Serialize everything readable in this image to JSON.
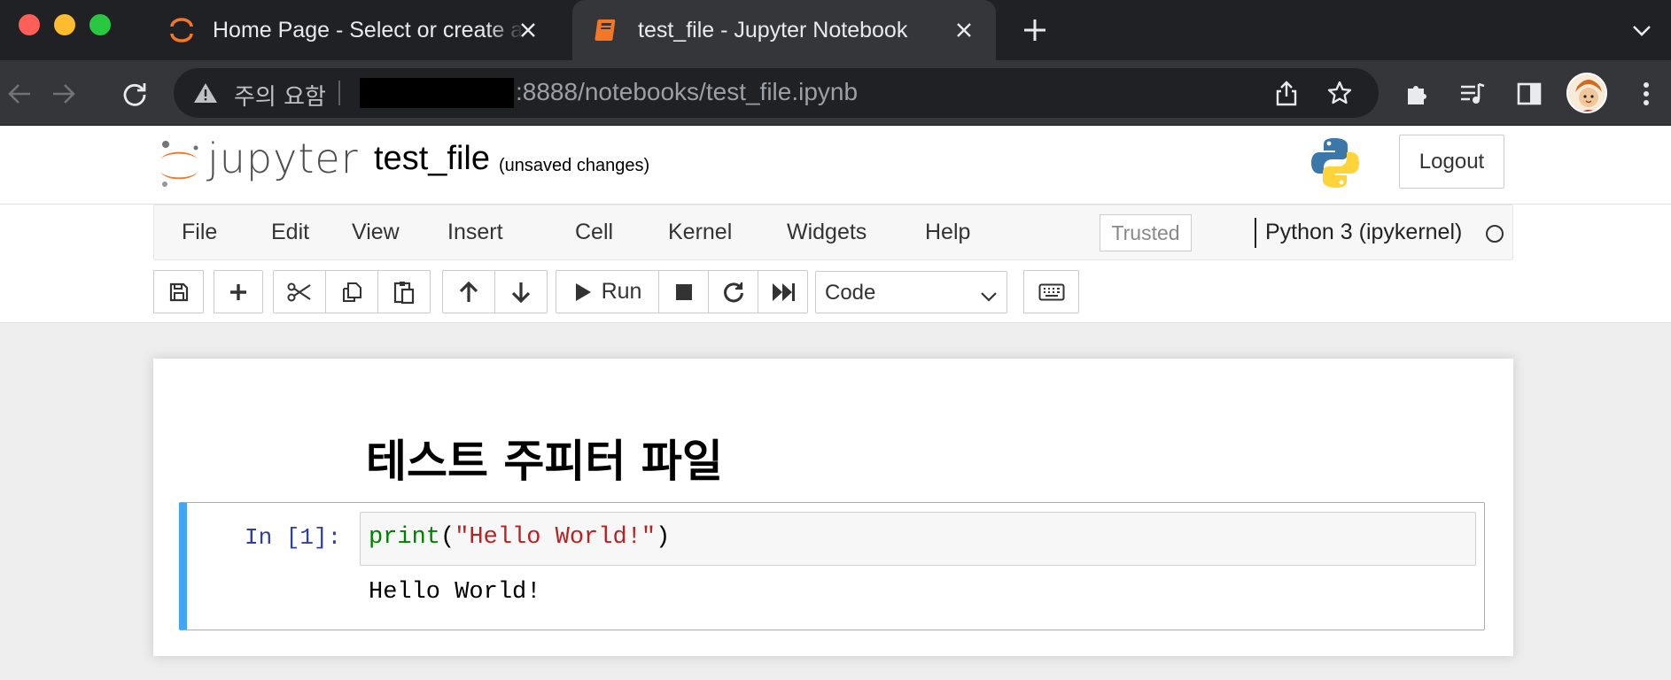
{
  "browser": {
    "tabs": [
      {
        "title": "Home Page - Select or create a notebook",
        "active": false
      },
      {
        "title": "test_file - Jupyter Notebook",
        "active": true
      }
    ],
    "security_label": "주의 요함",
    "url_visible": ":8888/notebooks/test_file.ipynb"
  },
  "header": {
    "logo_text": "jupyter",
    "notebook_name": "test_file",
    "save_status": "(unsaved changes)",
    "logout_label": "Logout"
  },
  "menubar": {
    "items": [
      "File",
      "Edit",
      "View",
      "Insert",
      "Cell",
      "Kernel",
      "Widgets",
      "Help"
    ],
    "trusted_label": "Trusted",
    "kernel_name": "Python 3 (ipykernel)"
  },
  "toolbar": {
    "run_label": "Run",
    "cell_type": "Code"
  },
  "notebook": {
    "markdown_heading": "테스트 주피터 파일",
    "cell": {
      "prompt": "In [1]:",
      "code_fn": "print",
      "code_open": "(",
      "code_string": "\"Hello World!\"",
      "code_close": ")",
      "output": "Hello World!"
    }
  },
  "colors": {
    "jupyter_orange": "#f37726",
    "cell_selected_border": "#42a5f5",
    "prompt_blue": "#303f9f",
    "keyword_green": "#008000",
    "string_red": "#ba2121"
  }
}
